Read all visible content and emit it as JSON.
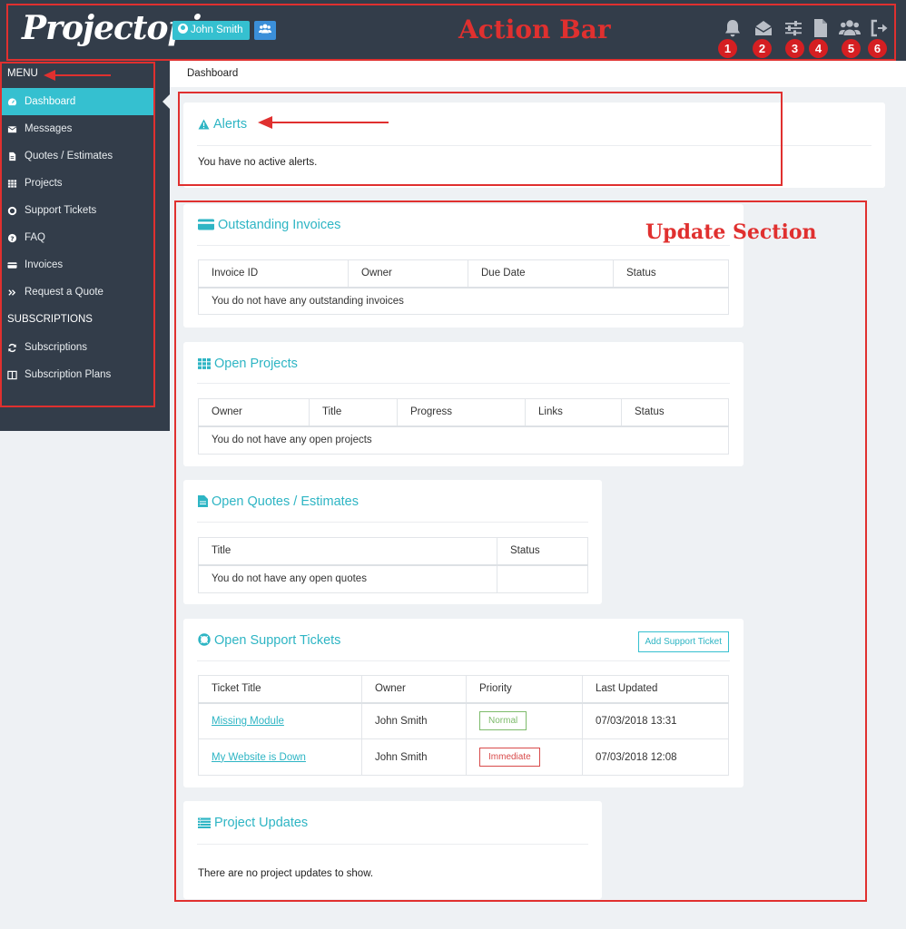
{
  "header": {
    "logo": "Projectopia",
    "user_name": "John Smith",
    "annotation_label": "Action Bar",
    "badges": [
      "1",
      "2",
      "3",
      "4",
      "5",
      "6"
    ],
    "icons": [
      "bell-icon",
      "envelope-open-icon",
      "sliders-icon",
      "file-icon",
      "users-icon",
      "sign-out-icon"
    ]
  },
  "sidebar": {
    "menu_heading": "MENU",
    "items": [
      {
        "label": "Dashboard",
        "icon": "dashboard-icon"
      },
      {
        "label": "Messages",
        "icon": "envelope-icon"
      },
      {
        "label": "Quotes / Estimates",
        "icon": "file-text-icon"
      },
      {
        "label": "Projects",
        "icon": "grid-icon"
      },
      {
        "label": "Support Tickets",
        "icon": "life-ring-icon"
      },
      {
        "label": "FAQ",
        "icon": "question-icon"
      },
      {
        "label": "Invoices",
        "icon": "credit-card-icon"
      },
      {
        "label": "Request a Quote",
        "icon": "double-chevron-icon"
      }
    ],
    "subscriptions_heading": "SUBSCRIPTIONS",
    "sub_items": [
      {
        "label": "Subscriptions",
        "icon": "refresh-icon"
      },
      {
        "label": "Subscription Plans",
        "icon": "columns-icon"
      }
    ]
  },
  "breadcrumb": "Dashboard",
  "update_section_label": "Update Section",
  "alerts": {
    "title": "Alerts",
    "message": "You have no active alerts."
  },
  "invoices": {
    "title": "Outstanding Invoices",
    "columns": [
      "Invoice ID",
      "Owner",
      "Due Date",
      "Status"
    ],
    "empty": "You do not have any outstanding invoices"
  },
  "projects": {
    "title": "Open Projects",
    "columns": [
      "Owner",
      "Title",
      "Progress",
      "Links",
      "Status"
    ],
    "empty": "You do not have any open projects"
  },
  "quotes": {
    "title": "Open Quotes / Estimates",
    "columns": [
      "Title",
      "Status"
    ],
    "empty": "You do not have any open quotes"
  },
  "tickets": {
    "title": "Open Support Tickets",
    "add_button": "Add Support Ticket",
    "columns": [
      "Ticket Title",
      "Owner",
      "Priority",
      "Last Updated"
    ],
    "rows": [
      {
        "title": "Missing Module",
        "owner": "John Smith",
        "priority": "Normal",
        "priority_color": "#7dbb6b",
        "updated": "07/03/2018 13:31"
      },
      {
        "title": "My Website is Down",
        "owner": "John Smith",
        "priority": "Immediate",
        "priority_color": "#d84a4a",
        "updated": "07/03/2018 12:08"
      }
    ]
  },
  "updates": {
    "title": "Project Updates",
    "message": "There are no project updates to show."
  },
  "colors": {
    "accent": "#35c0d0",
    "topbar": "#333d4a",
    "annotation": "#e0302f",
    "badge": "#d51f22"
  }
}
